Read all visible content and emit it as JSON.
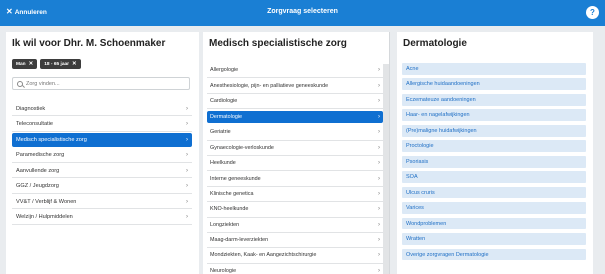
{
  "header": {
    "cancel_label": "Annuleren",
    "title": "Zorgvraag selecteren",
    "help_label": "?"
  },
  "column1": {
    "title": "Ik wil voor Dhr. M. Schoenmaker",
    "chips": [
      {
        "label": "Man"
      },
      {
        "label": "18 - 65 jaar"
      }
    ],
    "search_placeholder": "Zorg vinden...",
    "items": [
      {
        "label": "Diagnostiek",
        "selected": false
      },
      {
        "label": "Teleconsultatie",
        "selected": false
      },
      {
        "label": "Medisch specialistische zorg",
        "selected": true
      },
      {
        "label": "Paramedische zorg",
        "selected": false
      },
      {
        "label": "Aanvullende zorg",
        "selected": false
      },
      {
        "label": "GGZ / Jeugdzorg",
        "selected": false
      },
      {
        "label": "VV&T / Verblijf & Wonen",
        "selected": false
      },
      {
        "label": "Welzijn / Hulpmiddelen",
        "selected": false
      }
    ]
  },
  "column2": {
    "title": "Medisch specialistische zorg",
    "items": [
      {
        "label": "Allergologie",
        "selected": false
      },
      {
        "label": "Anesthesiologie, pijn- en palliatieve geneeskunde",
        "selected": false
      },
      {
        "label": "Cardiologie",
        "selected": false
      },
      {
        "label": "Dermatologie",
        "selected": true
      },
      {
        "label": "Geriatrie",
        "selected": false
      },
      {
        "label": "Gynaecologie-verloskunde",
        "selected": false
      },
      {
        "label": "Heelkunde",
        "selected": false
      },
      {
        "label": "Interne geneeskunde",
        "selected": false
      },
      {
        "label": "Klinische genetica",
        "selected": false
      },
      {
        "label": "KNO-heelkunde",
        "selected": false
      },
      {
        "label": "Longziekten",
        "selected": false
      },
      {
        "label": "Maag-darm-leverziekten",
        "selected": false
      },
      {
        "label": "Mondziekten, Kaak- en Aangezichtschirurgie",
        "selected": false
      },
      {
        "label": "Neurologie",
        "selected": false
      }
    ]
  },
  "column3": {
    "title": "Dermatologie",
    "items": [
      "Acne",
      "Allergische huidaandoeningen",
      "Eczemateuze aandoeningen",
      "Haar- en nagelafwijkingen",
      "(Pre)maligne huidafwijkingen",
      "Proctologie",
      "Psoriasis",
      "SOA",
      "Ulcus cruris",
      "Varices",
      "Wondproblemen",
      "Wratten",
      "Overige zorgvragen Dermatologie"
    ]
  },
  "colors": {
    "header_bg": "#1a7fd4",
    "selected_bg": "#0f6fd1",
    "chip_bg": "#3d3d3d",
    "option_bg": "#dce9f6",
    "option_text": "#1f6fc5",
    "panel_bg": "#e9ecef"
  }
}
